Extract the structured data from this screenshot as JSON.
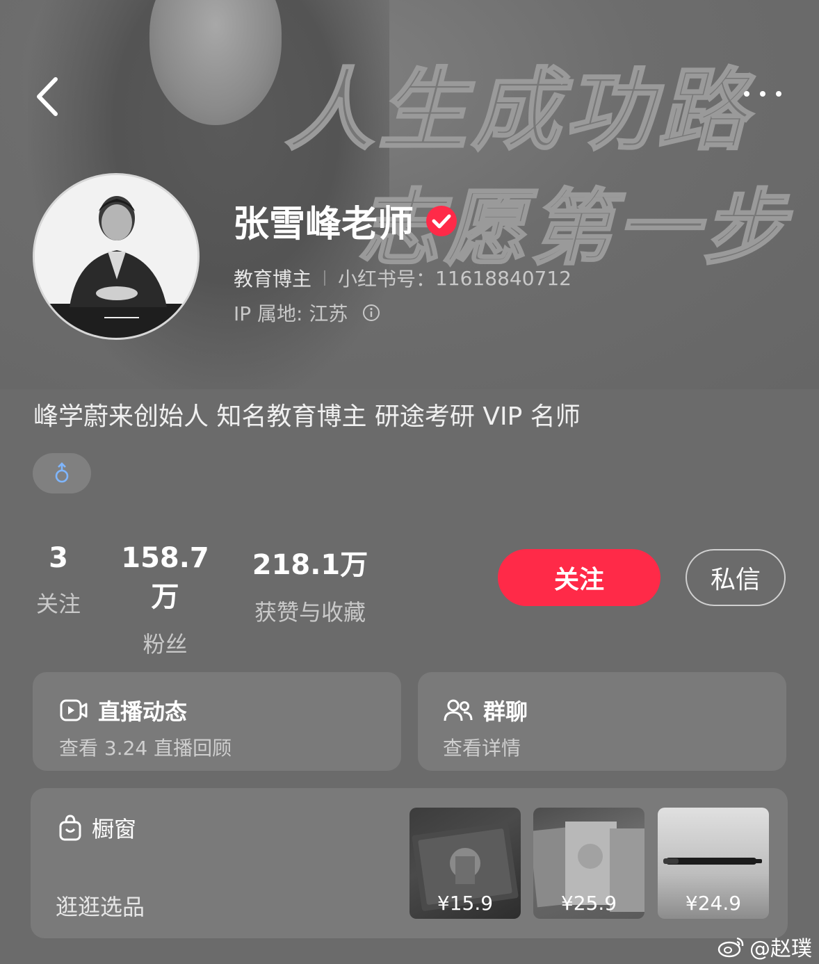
{
  "header": {
    "back_icon": "chevron-left-icon",
    "more_icon": "more-dots-icon",
    "slogan_line1": "人生成功路",
    "slogan_line2": "志愿第一步"
  },
  "profile": {
    "name": "张雪峰老师",
    "verified_icon": "verified-check-icon",
    "category": "教育博主",
    "red_id_label": "小红书号：",
    "red_id": "11618840712",
    "ip_label": "IP 属地: 江苏",
    "bio": "峰学蔚来创始人 知名教育博主 研途考研 VIP 名师",
    "gender_icon": "male-icon"
  },
  "stats": {
    "following": {
      "value": "3",
      "label": "关注"
    },
    "fans": {
      "value": "158.7万",
      "label": "粉丝"
    },
    "likes": {
      "value": "218.1万",
      "label": "获赞与收藏"
    }
  },
  "actions": {
    "follow_label": "关注",
    "message_label": "私信"
  },
  "cards": {
    "live": {
      "title": "直播动态",
      "sub": "查看 3.24 直播回顾",
      "icon": "live-video-icon"
    },
    "group": {
      "title": "群聊",
      "sub": "查看详情",
      "icon": "group-users-icon"
    },
    "shop": {
      "title": "橱窗",
      "sub": "逛逛选品",
      "icon": "shopping-bag-icon",
      "products": [
        {
          "price": "¥15.9"
        },
        {
          "price": "¥25.9"
        },
        {
          "price": "¥24.9"
        }
      ]
    }
  },
  "watermark": {
    "text": "@赵璞",
    "icon": "weibo-icon"
  },
  "colors": {
    "accent": "#ff2a48",
    "background": "#6b6b6b",
    "card": "#7a7a7a"
  }
}
